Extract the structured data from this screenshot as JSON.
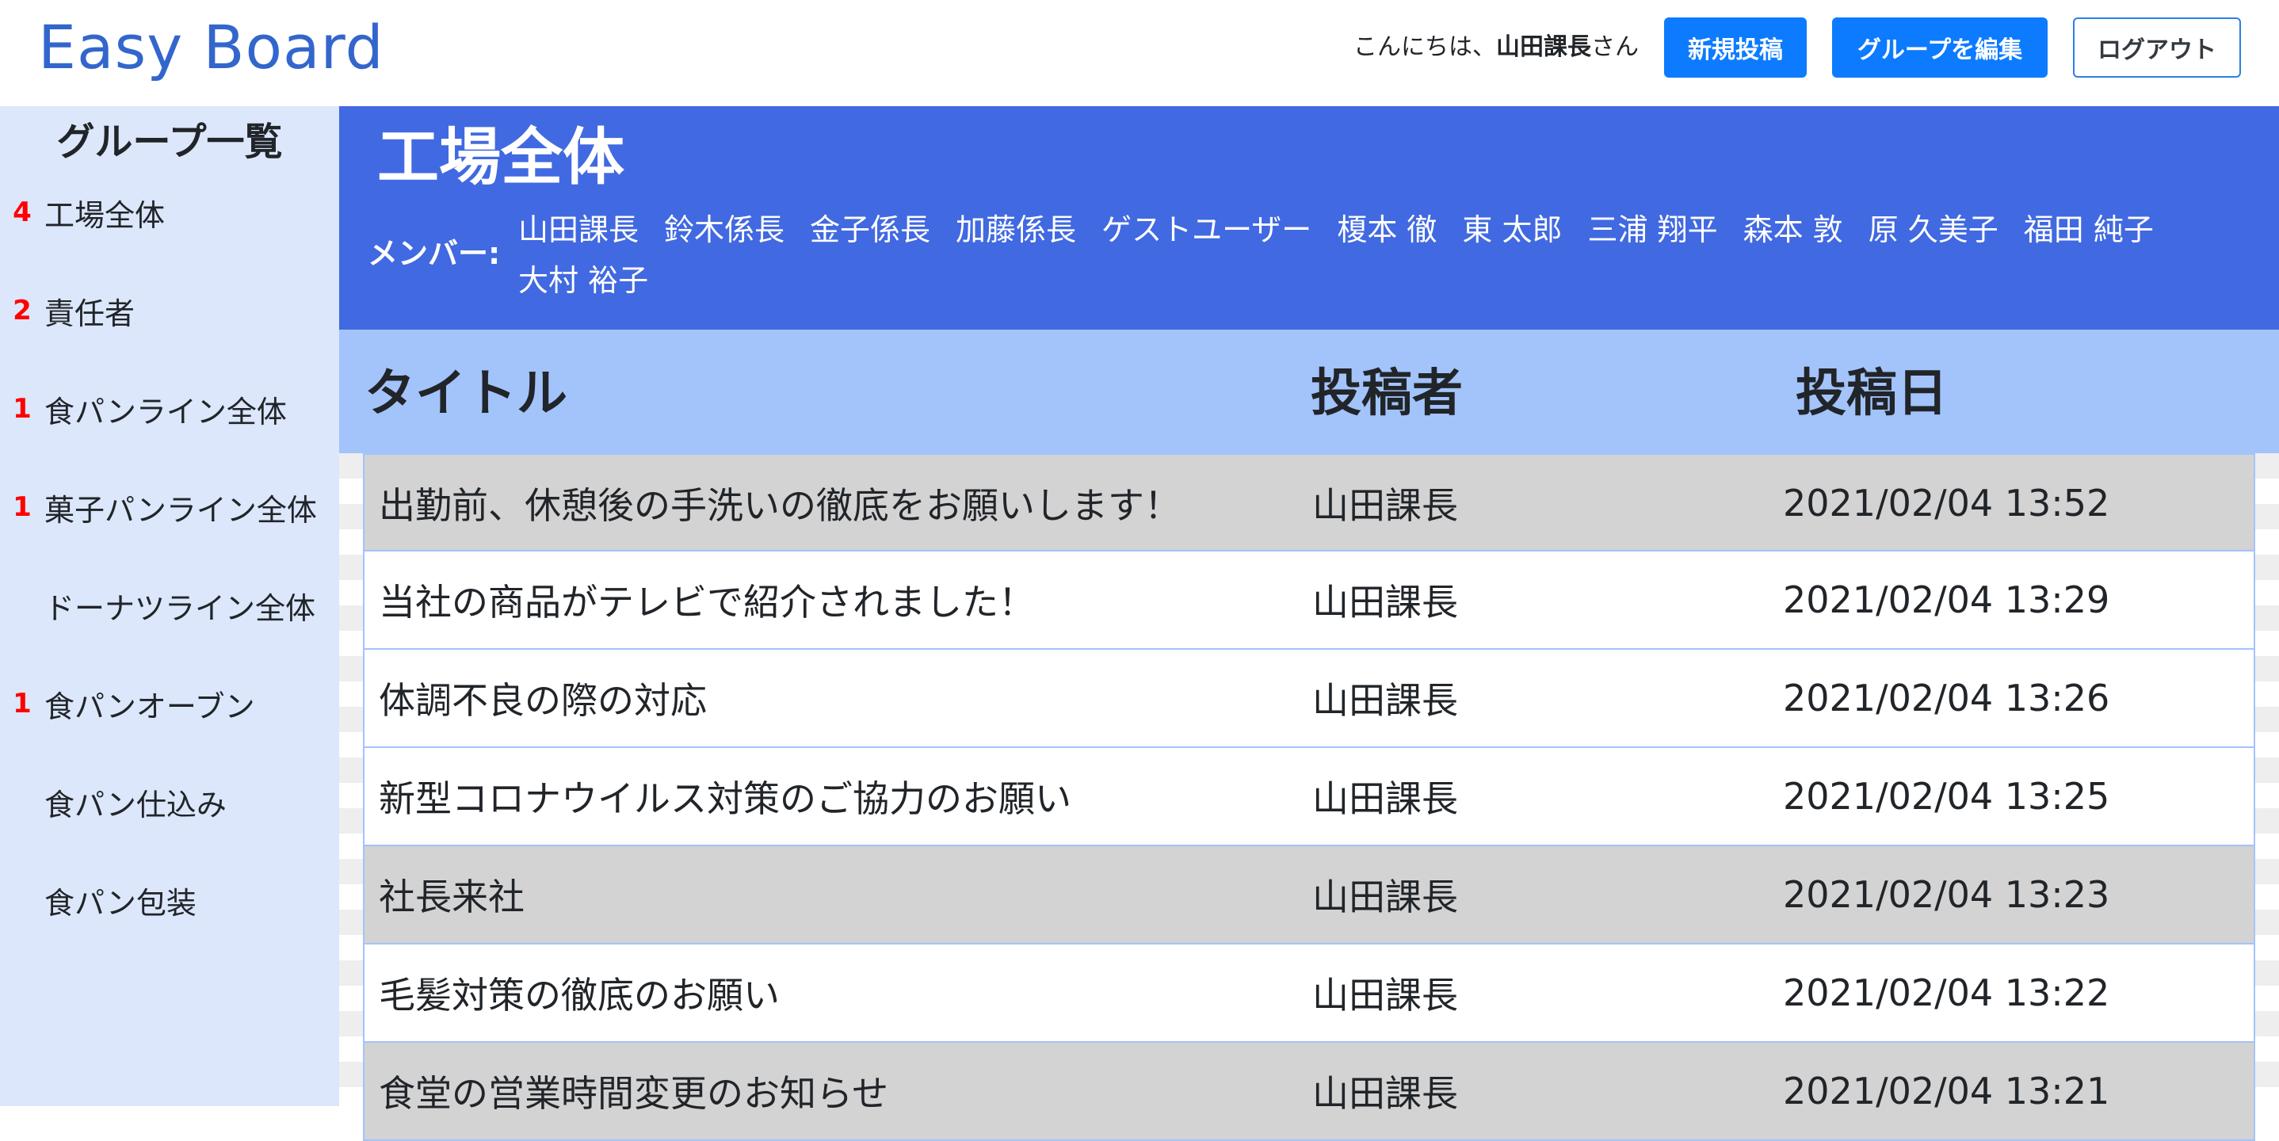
{
  "navbar": {
    "brand": "Easy Board",
    "greeting_prefix": "こんにちは、",
    "greeting_user": "山田課長",
    "greeting_suffix": "さん",
    "new_post_label": "新規投稿",
    "edit_group_label": "グループを編集",
    "logout_label": "ログアウト"
  },
  "sidebar": {
    "title": "グループ一覧",
    "items": [
      {
        "count": "4",
        "label": "工場全体"
      },
      {
        "count": "2",
        "label": "責任者"
      },
      {
        "count": "1",
        "label": "食パンライン全体"
      },
      {
        "count": "1",
        "label": "菓子パンライン全体"
      },
      {
        "count": "",
        "label": "ドーナツライン全体"
      },
      {
        "count": "1",
        "label": "食パンオーブン"
      },
      {
        "count": "",
        "label": "食パン仕込み"
      },
      {
        "count": "",
        "label": "食パン包装"
      }
    ]
  },
  "group": {
    "name": "工場全体",
    "members_label": "メンバー:",
    "members": [
      "山田課長",
      "鈴木係長",
      "金子係長",
      "加藤係長",
      "ゲストユーザー",
      "榎本 徹",
      "東 太郎",
      "三浦 翔平",
      "森本 敦",
      "原 久美子",
      "福田 純子",
      "大村 裕子"
    ]
  },
  "table": {
    "headers": {
      "title": "タイトル",
      "author": "投稿者",
      "date": "投稿日"
    },
    "rows": [
      {
        "title": "出勤前、休憩後の手洗いの徹底をお願いします！",
        "author": "山田課長",
        "date": "2021/02/04 13:52",
        "unread": true
      },
      {
        "title": "当社の商品がテレビで紹介されました！",
        "author": "山田課長",
        "date": "2021/02/04 13:29",
        "unread": false
      },
      {
        "title": "体調不良の際の対応",
        "author": "山田課長",
        "date": "2021/02/04 13:26",
        "unread": false
      },
      {
        "title": "新型コロナウイルス対策のご協力のお願い",
        "author": "山田課長",
        "date": "2021/02/04 13:25",
        "unread": false
      },
      {
        "title": "社長来社",
        "author": "山田課長",
        "date": "2021/02/04 13:23",
        "unread": true
      },
      {
        "title": "毛髪対策の徹底のお願い",
        "author": "山田課長",
        "date": "2021/02/04 13:22",
        "unread": false
      },
      {
        "title": "食堂の営業時間変更のお知らせ",
        "author": "山田課長",
        "date": "2021/02/04 13:21",
        "unread": true
      }
    ]
  }
}
